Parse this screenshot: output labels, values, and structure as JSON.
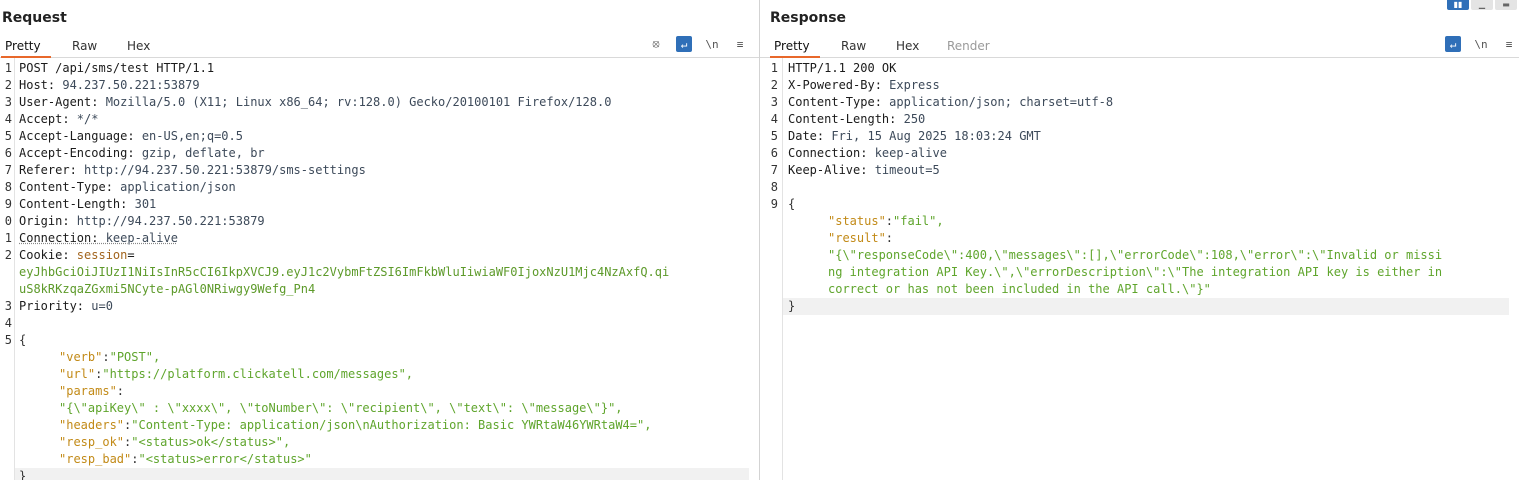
{
  "request": {
    "title": "Request",
    "tabs": [
      "Pretty",
      "Raw",
      "Hex"
    ],
    "tools": {
      "hide": "⦻",
      "wrap": "↵",
      "newline": "\\n",
      "menu": "≡"
    },
    "line_numbers": [
      "1",
      "2",
      "3",
      "4",
      "5",
      "6",
      "7",
      "8",
      "9",
      "0",
      "1",
      "2",
      "",
      "",
      "",
      "3",
      "4",
      "5"
    ],
    "http": {
      "request_line": "POST /api/sms/test HTTP/1.1",
      "headers": [
        {
          "k": "Host: ",
          "v": "94.237.50.221:53879"
        },
        {
          "k": "User-Agent: ",
          "v": "Mozilla/5.0 (X11; Linux x86_64; rv:128.0) Gecko/20100101 Firefox/128.0"
        },
        {
          "k": "Accept: ",
          "v": "*/*"
        },
        {
          "k": "Accept-Language: ",
          "v": "en-US,en;q=0.5"
        },
        {
          "k": "Accept-Encoding: ",
          "v": "gzip, deflate, br"
        },
        {
          "k": "Referer: ",
          "v": "http://94.237.50.221:53879/sms-settings"
        },
        {
          "k": "Content-Type: ",
          "v": "application/json"
        },
        {
          "k": "Content-Length: ",
          "v": "301"
        },
        {
          "k": "Origin: ",
          "v": "http://94.237.50.221:53879"
        },
        {
          "k": "Connection: ",
          "v": "keep-alive"
        }
      ],
      "cookie_key": "Cookie: ",
      "cookie_name": "session",
      "cookie_eq": "=",
      "cookie_value_1": "eyJhbGciOiJIUzI1NiIsInR5cCI6IkpXVCJ9.eyJ1c2VybmFtZSI6ImFkbWluIiwiaWF0IjoxNzU1Mjc4NzAxfQ.qi",
      "cookie_value_2": "uS8kRKzqaZGxmi5NCyte-pAGl0NRiwgy9Wefg_Pn4",
      "priority_key": "Priority: ",
      "priority_value": "u=0",
      "body_open": "{",
      "body": [
        {
          "k": "\"verb\"",
          "v": "\"POST\","
        },
        {
          "k": "\"url\"",
          "v": "\"https://platform.clickatell.com/messages\","
        },
        {
          "k": "\"params\"",
          "v": ""
        },
        {
          "k": "",
          "v": "\"{\\\"apiKey\\\" : \\\"xxxx\\\", \\\"toNumber\\\": \\\"recipient\\\", \\\"text\\\": \\\"message\\\"}\","
        },
        {
          "k": "\"headers\"",
          "v": "\"Content-Type: application/json\\nAuthorization: Basic YWRtaW46YWRtaW4=\","
        },
        {
          "k": "\"resp_ok\"",
          "v": "\"<status>ok</status>\","
        },
        {
          "k": "\"resp_bad\"",
          "v": "\"<status>error</status>\""
        }
      ],
      "body_close": "}"
    }
  },
  "response": {
    "title": "Response",
    "tabs": [
      "Pretty",
      "Raw",
      "Hex",
      "Render"
    ],
    "tools": {
      "wrap": "↵",
      "newline": "\\n",
      "menu": "≡"
    },
    "line_numbers": [
      "1",
      "2",
      "3",
      "4",
      "5",
      "6",
      "7",
      "8",
      "9"
    ],
    "status_line": "HTTP/1.1 200 OK",
    "headers": [
      {
        "k": "X-Powered-By: ",
        "v": "Express"
      },
      {
        "k": "Content-Type: ",
        "v": "application/json; charset=utf-8"
      },
      {
        "k": "Content-Length: ",
        "v": "250"
      },
      {
        "k": "Date: ",
        "v": "Fri, 15 Aug 2025 18:03:24 GMT"
      },
      {
        "k": "Connection: ",
        "v": "keep-alive"
      },
      {
        "k": "Keep-Alive: ",
        "v": "timeout=5"
      }
    ],
    "body_open": "{",
    "status_key": "\"status\"",
    "status_value": "\"fail\",",
    "result_key": "\"result\"",
    "result_lines": [
      "\"{\\\"responseCode\\\":400,\\\"messages\\\":[],\\\"errorCode\\\":108,\\\"error\\\":\\\"Invalid or missi",
      "ng integration API Key.\\\",\\\"errorDescription\\\":\\\"The integration API key is either in",
      "correct or has not been included in the API call.\\\"}\""
    ],
    "body_close": "}"
  },
  "window_controls": [
    "▮▮",
    "▁",
    "▬"
  ]
}
